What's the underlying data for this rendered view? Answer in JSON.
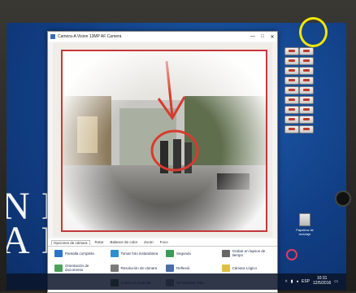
{
  "window": {
    "title": "Camera-A Vision 13MP AF Camera",
    "controls": [
      "—",
      "□",
      "✕"
    ]
  },
  "desktop": {
    "left_text_top": "NI",
    "left_text_bottom": "AF"
  },
  "ribbon": {
    "tabs": [
      {
        "label": "Opciones de cámara",
        "active": true
      },
      {
        "label": "Rotar",
        "active": false
      },
      {
        "label": "Balance de color",
        "active": false
      },
      {
        "label": "Zoom",
        "active": false
      },
      {
        "label": "Foco",
        "active": false
      }
    ],
    "buttons": [
      {
        "label": "Pantalla completa",
        "icon": "fullscreen-icon",
        "color": "#2c74c9"
      },
      {
        "label": "Tomar foto instantánea",
        "icon": "camera-snapshot-icon",
        "color": "#2e8fd0"
      },
      {
        "label": "Segundo",
        "icon": "image-icon",
        "color": "#3d9a55"
      },
      {
        "label": "Grabar en lapsos de tiempo",
        "icon": "video-record-icon",
        "color": "#666666"
      },
      {
        "label": "Orientación de documento",
        "icon": "document-orientation-icon",
        "color": "#4aa35a"
      },
      {
        "label": "Resolución de cámara",
        "icon": "camera-resolution-icon",
        "color": "#7a7a7a"
      },
      {
        "label": "Reflexió",
        "icon": "reflection-icon",
        "color": "#4a6ea8"
      },
      {
        "label": "Cámara Lógico",
        "icon": "lightbulb-icon",
        "color": "#e0c040"
      },
      {
        "label": "Activar el modo de",
        "icon": "activate-mode-icon",
        "color": "#556b2f"
      },
      {
        "label": "Sel Window Title",
        "icon": "window-title-icon",
        "color": "#8a8a8a"
      }
    ]
  },
  "desktop_icons": {
    "recycle_bin_label": "Papelera de reciclaje"
  },
  "taskbar": {
    "time": "10:31",
    "date": "12/5/2016",
    "lang": "ESP"
  },
  "colors": {
    "annotation": "#d93a2e",
    "highlight_circle": "#f3e600",
    "desktop_bg": "#1f5fae"
  }
}
